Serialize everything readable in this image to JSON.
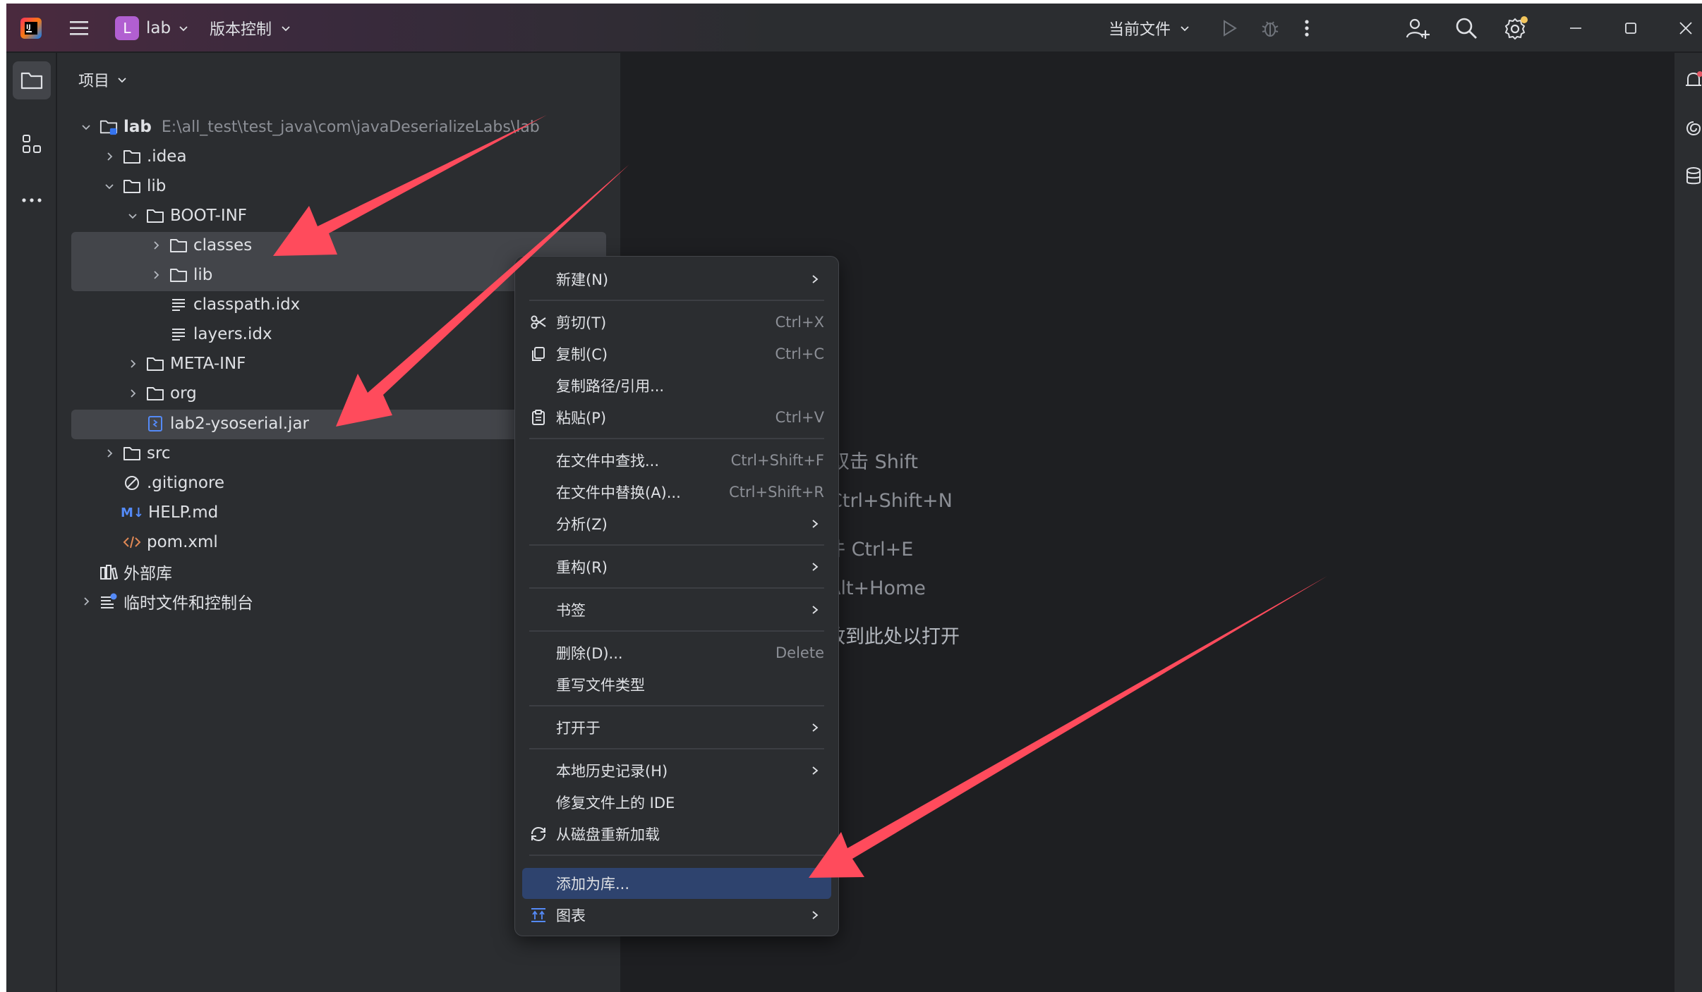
{
  "titlebar": {
    "project_badge": "L",
    "project_name": "lab",
    "vcs_label": "版本控制",
    "run_config": "当前文件"
  },
  "project_panel": {
    "title": "项目",
    "tree": [
      {
        "label": "lab",
        "path": "E:\\all_test\\test_java\\com\\javaDeserializeLabs\\lab"
      },
      {
        "label": ".idea"
      },
      {
        "label": "lib"
      },
      {
        "label": "BOOT-INF"
      },
      {
        "label": "classes"
      },
      {
        "label": "lib"
      },
      {
        "label": "classpath.idx"
      },
      {
        "label": "layers.idx"
      },
      {
        "label": "META-INF"
      },
      {
        "label": "org"
      },
      {
        "label": "lab2-ysoserial.jar"
      },
      {
        "label": "src"
      },
      {
        "label": ".gitignore"
      },
      {
        "label": "HELP.md",
        "badge": "M↓"
      },
      {
        "label": "pom.xml"
      },
      {
        "label": "外部库"
      },
      {
        "label": "临时文件和控制台"
      }
    ]
  },
  "context_menu": {
    "items": [
      {
        "label": "新建(N)",
        "shortcut": ""
      },
      {
        "label": "剪切(T)",
        "shortcut": "Ctrl+X"
      },
      {
        "label": "复制(C)",
        "shortcut": "Ctrl+C"
      },
      {
        "label": "复制路径/引用...",
        "shortcut": ""
      },
      {
        "label": "粘贴(P)",
        "shortcut": "Ctrl+V"
      },
      {
        "label": "在文件中查找...",
        "shortcut": "Ctrl+Shift+F"
      },
      {
        "label": "在文件中替换(A)...",
        "shortcut": "Ctrl+Shift+R"
      },
      {
        "label": "分析(Z)",
        "shortcut": ""
      },
      {
        "label": "重构(R)",
        "shortcut": ""
      },
      {
        "label": "书签",
        "shortcut": ""
      },
      {
        "label": "删除(D)...",
        "shortcut": "Delete"
      },
      {
        "label": "重写文件类型",
        "shortcut": ""
      },
      {
        "label": "打开于",
        "shortcut": ""
      },
      {
        "label": "本地历史记录(H)",
        "shortcut": ""
      },
      {
        "label": "修复文件上的 IDE",
        "shortcut": ""
      },
      {
        "label": "从磁盘重新加载",
        "shortcut": ""
      },
      {
        "label": "添加为库...",
        "shortcut": ""
      },
      {
        "label": "图表",
        "shortcut": ""
      }
    ]
  },
  "editor_hints": [
    "双击 Shift",
    "Ctrl+Shift+N",
    "件  Ctrl+E",
    "Alt+Home",
    "放到此处以打开"
  ],
  "colors": {
    "accent": "#2e436e",
    "arrow": "#ff4b5c",
    "badge": "#b15fd1"
  }
}
